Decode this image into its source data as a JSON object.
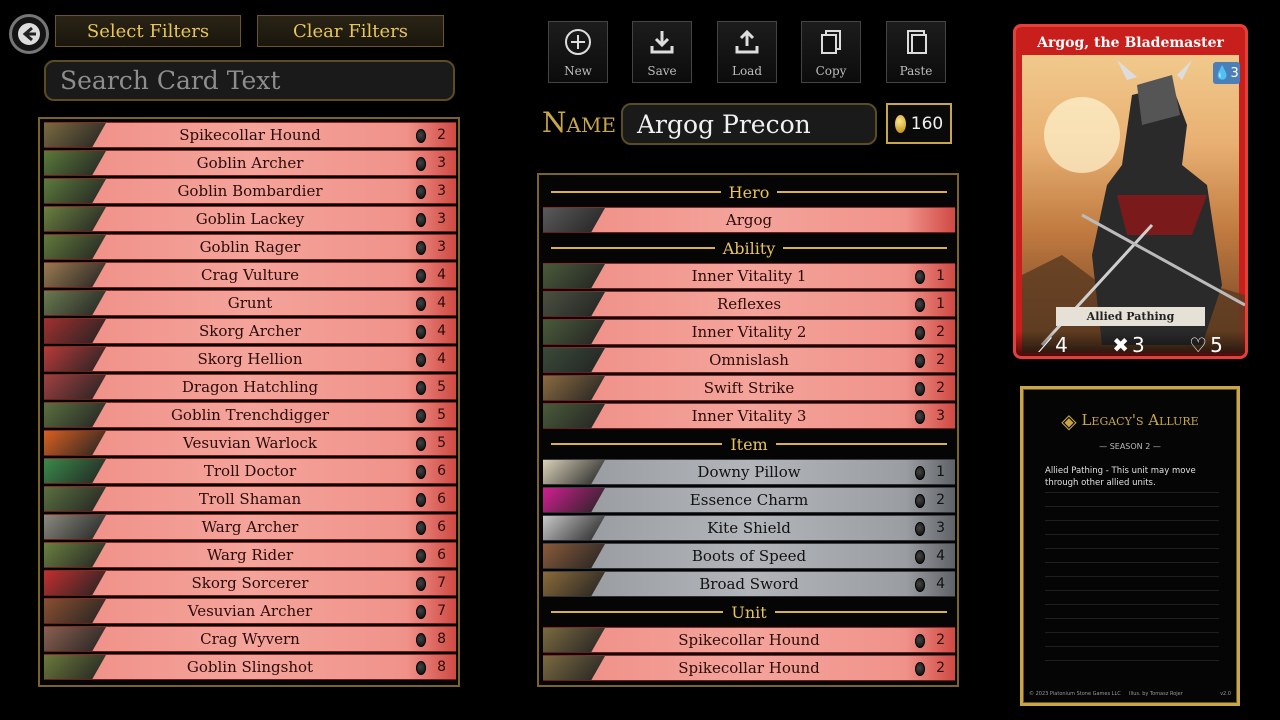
{
  "toolbar_left": {
    "select_filters": "Select Filters",
    "clear_filters": "Clear Filters",
    "search_placeholder": "Search Card Text"
  },
  "library": [
    {
      "name": "Spikecollar Hound",
      "cost": "2",
      "hue": "#7a6a40"
    },
    {
      "name": "Goblin Archer",
      "cost": "3",
      "hue": "#5a7a3a"
    },
    {
      "name": "Goblin Bombardier",
      "cost": "3",
      "hue": "#5c7a3c"
    },
    {
      "name": "Goblin Lackey",
      "cost": "3",
      "hue": "#6a8040"
    },
    {
      "name": "Goblin Rager",
      "cost": "3",
      "hue": "#607a3a"
    },
    {
      "name": "Crag Vulture",
      "cost": "4",
      "hue": "#9a7a50"
    },
    {
      "name": "Grunt",
      "cost": "4",
      "hue": "#6a7a50"
    },
    {
      "name": "Skorg Archer",
      "cost": "4",
      "hue": "#a03030"
    },
    {
      "name": "Skorg Hellion",
      "cost": "4",
      "hue": "#b83a3a"
    },
    {
      "name": "Dragon Hatchling",
      "cost": "5",
      "hue": "#a04040"
    },
    {
      "name": "Goblin Trenchdigger",
      "cost": "5",
      "hue": "#5a7040"
    },
    {
      "name": "Vesuvian Warlock",
      "cost": "5",
      "hue": "#d86020"
    },
    {
      "name": "Troll Doctor",
      "cost": "6",
      "hue": "#3a8a4a"
    },
    {
      "name": "Troll Shaman",
      "cost": "6",
      "hue": "#5a7040"
    },
    {
      "name": "Warg Archer",
      "cost": "6",
      "hue": "#8a8a80"
    },
    {
      "name": "Warg Rider",
      "cost": "6",
      "hue": "#6a8040"
    },
    {
      "name": "Skorg Sorcerer",
      "cost": "7",
      "hue": "#c03030"
    },
    {
      "name": "Vesuvian Archer",
      "cost": "7",
      "hue": "#8a5030"
    },
    {
      "name": "Crag Wyvern",
      "cost": "8",
      "hue": "#8a6050"
    },
    {
      "name": "Goblin Slingshot",
      "cost": "8",
      "hue": "#6a7a3a"
    }
  ],
  "tools": [
    {
      "label": "New",
      "icon": "plus-circle-icon"
    },
    {
      "label": "Save",
      "icon": "download-icon"
    },
    {
      "label": "Load",
      "icon": "upload-icon"
    },
    {
      "label": "Copy",
      "icon": "copy-icon"
    },
    {
      "label": "Paste",
      "icon": "paste-icon"
    }
  ],
  "deck": {
    "name_label": "Name",
    "name_value": "Argog Precon",
    "total_cost": "160"
  },
  "sections": {
    "hero": {
      "title": "Hero",
      "rows": [
        {
          "name": "Argog",
          "cost": "",
          "hue": "#5a5a5a"
        }
      ]
    },
    "ability": {
      "title": "Ability",
      "rows": [
        {
          "name": "Inner Vitality 1",
          "cost": "1",
          "hue": "#4a5a3a"
        },
        {
          "name": "Reflexes",
          "cost": "1",
          "hue": "#4a5040"
        },
        {
          "name": "Inner Vitality 2",
          "cost": "2",
          "hue": "#4a5a3a"
        },
        {
          "name": "Omnislash",
          "cost": "2",
          "hue": "#3a4a3a"
        },
        {
          "name": "Swift Strike",
          "cost": "2",
          "hue": "#8a6a40"
        },
        {
          "name": "Inner Vitality 3",
          "cost": "3",
          "hue": "#4a5a3a"
        }
      ]
    },
    "item": {
      "title": "Item",
      "rows": [
        {
          "name": "Downy Pillow",
          "cost": "1",
          "hue": "#d8d0b8"
        },
        {
          "name": "Essence Charm",
          "cost": "2",
          "hue": "#d02090"
        },
        {
          "name": "Kite Shield",
          "cost": "3",
          "hue": "#c8c8c8"
        },
        {
          "name": "Boots of Speed",
          "cost": "4",
          "hue": "#8a5a3a"
        },
        {
          "name": "Broad Sword",
          "cost": "4",
          "hue": "#8a6a3a"
        }
      ]
    },
    "unit": {
      "title": "Unit",
      "rows": [
        {
          "name": "Spikecollar Hound",
          "cost": "2",
          "hue": "#7a6a40"
        },
        {
          "name": "Spikecollar Hound",
          "cost": "2",
          "hue": "#7a6a40"
        }
      ]
    }
  },
  "preview": {
    "title": "Argog, the Blademaster",
    "cost": "3",
    "trait": "Allied Pathing",
    "attack": "4",
    "range": "3",
    "health": "5"
  },
  "rules": {
    "brand": "Legacy's Allure",
    "season": "SEASON 2",
    "text": "Allied Pathing - This unit may move through other allied units.",
    "copyright": "© 2023 Platonium Stone Games LLC",
    "illus": "Illus. by Tomasz Rojer",
    "version": "v2.0"
  }
}
